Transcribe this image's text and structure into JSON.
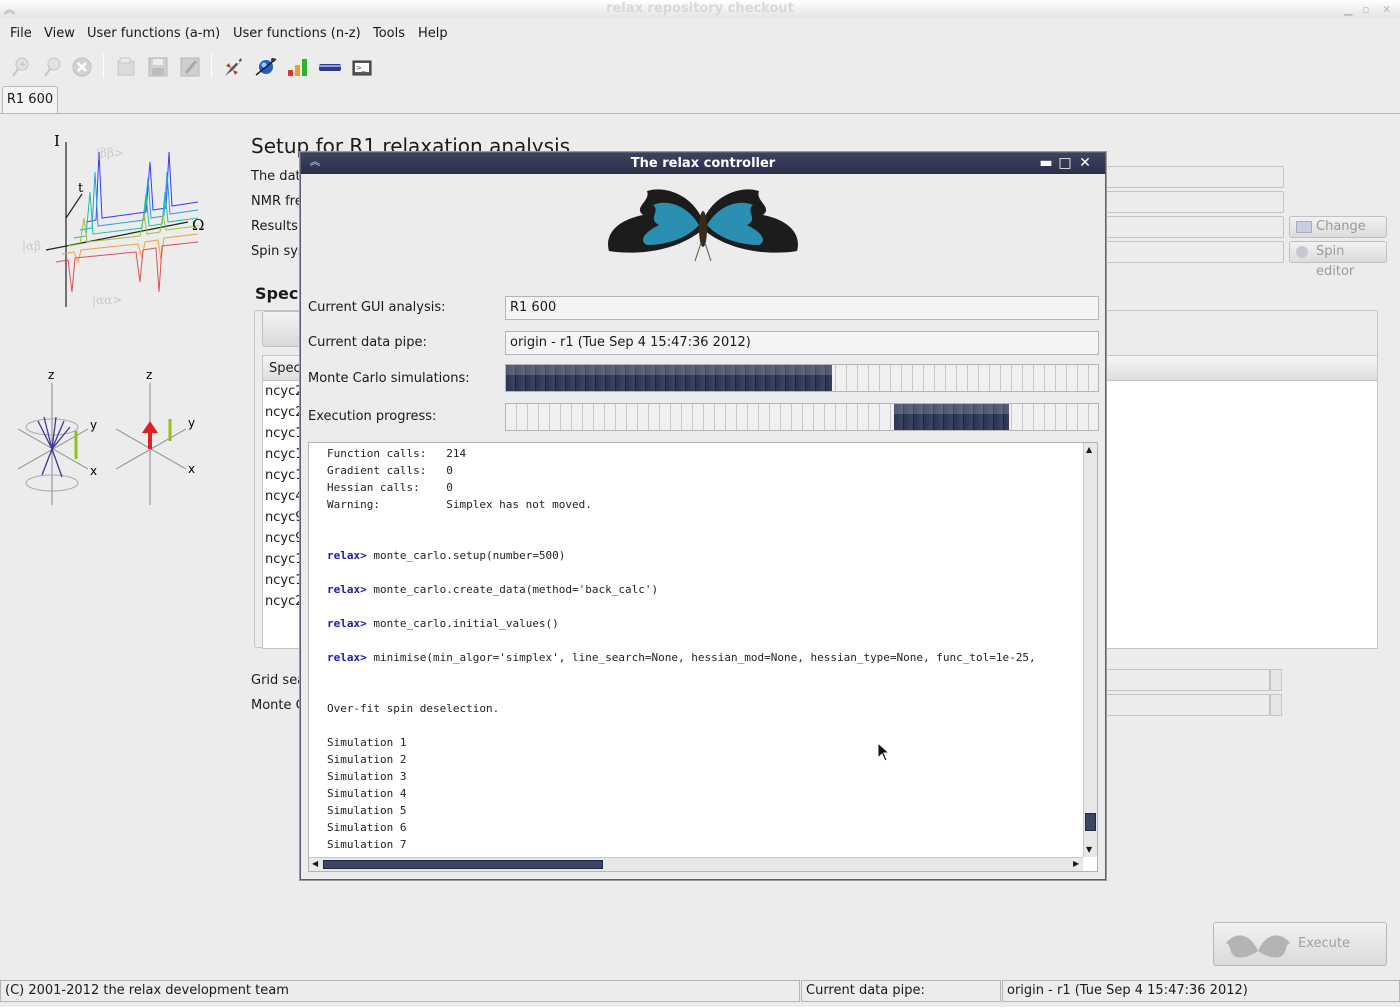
{
  "window": {
    "title": "relax repository checkout"
  },
  "menubar": {
    "items": [
      "File",
      "View",
      "User functions (a-m)",
      "User functions (n-z)",
      "Tools",
      "Help"
    ]
  },
  "toolbar": {
    "icons": [
      "new-analysis-icon",
      "close-analysis-icon",
      "close-all-icon",
      "open-icon",
      "save-icon",
      "save-as-icon",
      "controller-icon",
      "spin-viewer-icon",
      "results-viewer-icon",
      "pipe-editor-icon",
      "prompt-icon"
    ]
  },
  "tab": {
    "label": "R1 600"
  },
  "analysis": {
    "title": "Setup for R1 relaxation analysis",
    "labels": {
      "data_pipe": "The dat",
      "nmr_freq": "NMR fre",
      "results": "Results",
      "spin_sys": "Spin sys",
      "spectra_section": "Spec",
      "table_col": "Spec",
      "grid_search": "Grid sea",
      "monte_carlo": "Monte C"
    },
    "spectra_rows": [
      "ncyc2",
      "ncyc2",
      "ncyc1",
      "ncyc1",
      "ncyc1",
      "ncyc4",
      "ncyc9",
      "ncyc9",
      "ncyc1",
      "ncyc1",
      "ncyc2"
    ],
    "change_button": "Change",
    "spin_editor_button": "Spin editor",
    "execute_button": "Execute relax"
  },
  "graphic": {
    "axis_I": "I",
    "axis_t": "t",
    "axis_omega": "Ω",
    "state_bb": "|ββ>",
    "state_ab": "|αβ",
    "state_aa": "|αα>",
    "z1": "z",
    "y1": "y",
    "x1": "x",
    "z2": "z",
    "y2": "y",
    "x2": "x"
  },
  "status_bar": {
    "copyright": "(C) 2001-2012 the relax development team",
    "pipe_label": "Current data pipe:",
    "pipe_value": "origin - r1 (Tue Sep  4 15:47:36 2012)"
  },
  "controller": {
    "title": "The relax controller",
    "gui_analysis_label": "Current GUI analysis:",
    "gui_analysis_value": "R1 600",
    "data_pipe_label": "Current data pipe:",
    "data_pipe_value": "origin - r1 (Tue Sep  4 15:47:36 2012)",
    "mc_label": "Monte Carlo simulations:",
    "mc_progress": 0.55,
    "exec_label": "Execution progress:",
    "exec_pulse_start": 0.655,
    "exec_pulse_end": 0.85,
    "log": [
      {
        "prompt": "",
        "text": "Function calls:   214"
      },
      {
        "prompt": "",
        "text": "Gradient calls:   0"
      },
      {
        "prompt": "",
        "text": "Hessian calls:    0"
      },
      {
        "prompt": "",
        "text": "Warning:          Simplex has not moved."
      },
      {
        "prompt": "",
        "text": ""
      },
      {
        "prompt": "",
        "text": ""
      },
      {
        "prompt": "relax>",
        "text": " monte_carlo.setup(number=500)"
      },
      {
        "prompt": "",
        "text": ""
      },
      {
        "prompt": "relax>",
        "text": " monte_carlo.create_data(method='back_calc')"
      },
      {
        "prompt": "",
        "text": ""
      },
      {
        "prompt": "relax>",
        "text": " monte_carlo.initial_values()"
      },
      {
        "prompt": "",
        "text": ""
      },
      {
        "prompt": "relax>",
        "text": " minimise(min_algor='simplex', line_search=None, hessian_mod=None, hessian_type=None, func_tol=1e-25,"
      },
      {
        "prompt": "",
        "text": ""
      },
      {
        "prompt": "",
        "text": ""
      },
      {
        "prompt": "",
        "text": "Over-fit spin deselection."
      },
      {
        "prompt": "",
        "text": ""
      },
      {
        "prompt": "",
        "text": "Simulation 1"
      },
      {
        "prompt": "",
        "text": "Simulation 2"
      },
      {
        "prompt": "",
        "text": "Simulation 3"
      },
      {
        "prompt": "",
        "text": "Simulation 4"
      },
      {
        "prompt": "",
        "text": "Simulation 5"
      },
      {
        "prompt": "",
        "text": "Simulation 6"
      },
      {
        "prompt": "",
        "text": "Simulation 7"
      }
    ]
  },
  "colors": {
    "title_dark": "#2b2f48",
    "progress": "#2c3252",
    "prompt": "#1a1ab0"
  }
}
